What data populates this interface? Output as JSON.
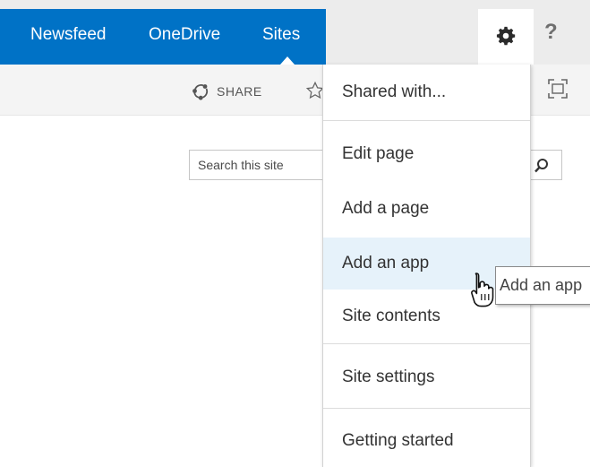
{
  "suite_bar": {
    "nav": [
      "Newsfeed",
      "OneDrive",
      "Sites"
    ],
    "active": "Sites",
    "settings_icon": "gear-icon",
    "help_label": "?",
    "brand_color": "#0072c6"
  },
  "toolbar": {
    "share_label": "SHARE",
    "share_icon": "share-icon",
    "follow_icon": "star-icon",
    "focus_icon": "focus-on-content-icon"
  },
  "search": {
    "placeholder": "Search this site",
    "icon": "search-icon"
  },
  "settings_menu": {
    "groups": [
      [
        "Shared with..."
      ],
      [
        "Edit page",
        "Add a page",
        "Add an app",
        "Site contents"
      ],
      [
        "Site settings"
      ],
      [
        "Getting started"
      ]
    ],
    "hovered": "Add an app",
    "highlight_color": "#e6f2fa"
  },
  "tooltip": {
    "text": "Add an app"
  },
  "cursor_icon": "hand-pointer-icon"
}
